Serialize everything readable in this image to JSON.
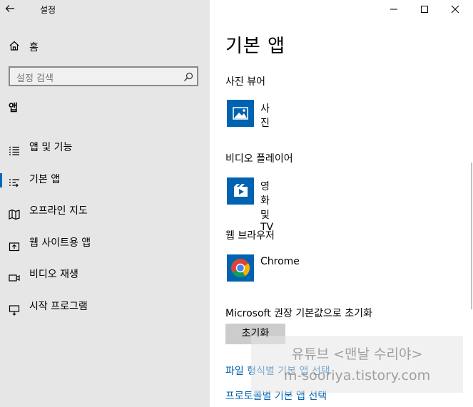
{
  "window": {
    "title": "설정",
    "minimize_glyph": "—",
    "maximize_glyph": "☐",
    "close_glyph": "✕"
  },
  "sidebar": {
    "home_label": "홈",
    "search_placeholder": "설정 검색",
    "section_title": "앱",
    "items": [
      {
        "label": "앱 및 기능",
        "icon": "apps-features-icon",
        "active": false
      },
      {
        "label": "기본 앱",
        "icon": "default-apps-icon",
        "active": true
      },
      {
        "label": "오프라인 지도",
        "icon": "offline-maps-icon",
        "active": false
      },
      {
        "label": "웹 사이트용 앱",
        "icon": "apps-for-websites-icon",
        "active": false
      },
      {
        "label": "비디오 재생",
        "icon": "video-playback-icon",
        "active": false
      },
      {
        "label": "시작 프로그램",
        "icon": "startup-icon",
        "active": false
      }
    ]
  },
  "main": {
    "page_title": "기본 앱",
    "photo_viewer": {
      "category": "사진 뷰어",
      "app": "사진"
    },
    "video_player": {
      "category": "비디오 플레이어",
      "app": "영화 및 TV"
    },
    "web_browser": {
      "category": "웹 브라우저",
      "app": "Chrome"
    },
    "reset": {
      "label": "Microsoft 권장 기본값으로 초기화",
      "button": "초기화"
    },
    "links": [
      "파일 형식별 기본 앱 선택",
      "프로토콜별 기본 앱 선택"
    ]
  },
  "watermark": {
    "line1": "유튜브 <맨날 수리야>",
    "line2": "m-sooriya.tistory.com"
  },
  "colors": {
    "accent": "#0067c0",
    "tile_blue": "#0063b1",
    "sidebar_bg": "#e6e6e6",
    "link": "#0063b1"
  }
}
